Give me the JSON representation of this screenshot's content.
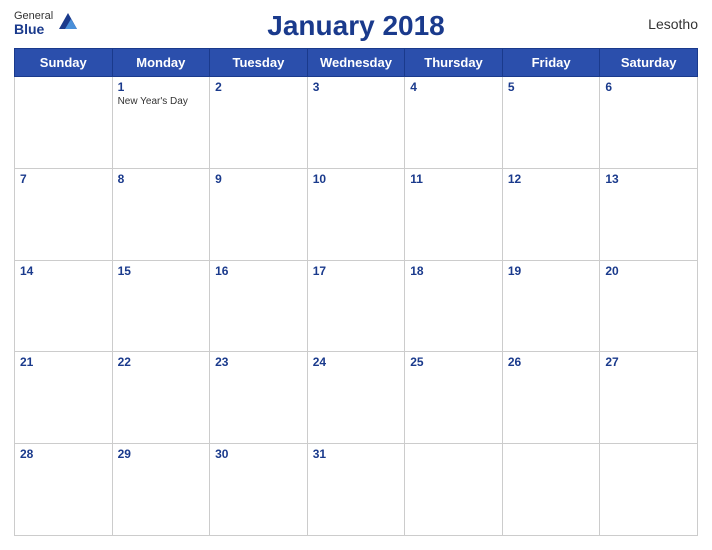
{
  "header": {
    "title": "January 2018",
    "country": "Lesotho",
    "logo_general": "General",
    "logo_blue": "Blue"
  },
  "weekdays": [
    "Sunday",
    "Monday",
    "Tuesday",
    "Wednesday",
    "Thursday",
    "Friday",
    "Saturday"
  ],
  "weeks": [
    [
      {
        "day": "",
        "empty": true
      },
      {
        "day": "1",
        "holiday": "New Year's Day"
      },
      {
        "day": "2"
      },
      {
        "day": "3"
      },
      {
        "day": "4"
      },
      {
        "day": "5"
      },
      {
        "day": "6"
      }
    ],
    [
      {
        "day": "7"
      },
      {
        "day": "8"
      },
      {
        "day": "9"
      },
      {
        "day": "10"
      },
      {
        "day": "11"
      },
      {
        "day": "12"
      },
      {
        "day": "13"
      }
    ],
    [
      {
        "day": "14"
      },
      {
        "day": "15"
      },
      {
        "day": "16"
      },
      {
        "day": "17"
      },
      {
        "day": "18"
      },
      {
        "day": "19"
      },
      {
        "day": "20"
      }
    ],
    [
      {
        "day": "21"
      },
      {
        "day": "22"
      },
      {
        "day": "23"
      },
      {
        "day": "24"
      },
      {
        "day": "25"
      },
      {
        "day": "26"
      },
      {
        "day": "27"
      }
    ],
    [
      {
        "day": "28"
      },
      {
        "day": "29"
      },
      {
        "day": "30"
      },
      {
        "day": "31"
      },
      {
        "day": ""
      },
      {
        "day": ""
      },
      {
        "day": ""
      }
    ]
  ]
}
